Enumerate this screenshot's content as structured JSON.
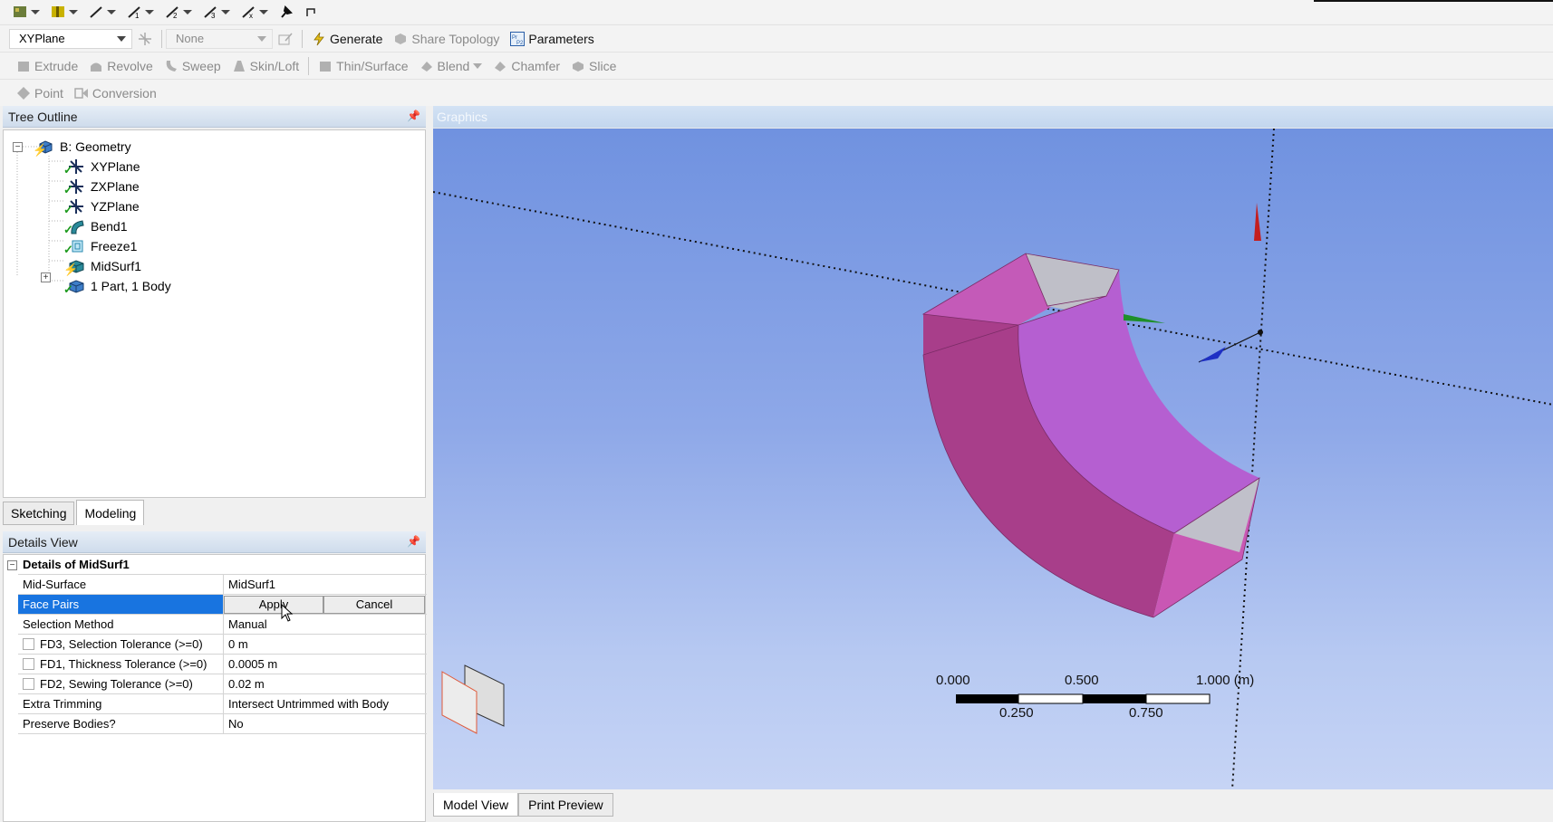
{
  "toolbar1": {
    "icons": [
      "new-sketch-icon",
      "layer-icon",
      "line-tool-1-icon",
      "line-tool-2-icon",
      "line-tool-3-icon",
      "line-tool-4-icon",
      "line-tool-x-icon",
      "pin-tool-icon",
      "select-box-icon"
    ]
  },
  "toolbar2": {
    "plane_select": "XYPlane",
    "sketch_select": "None",
    "generate": "Generate",
    "share_topology": "Share Topology",
    "parameters": "Parameters"
  },
  "toolbar3": {
    "extrude": "Extrude",
    "revolve": "Revolve",
    "sweep": "Sweep",
    "skin_loft": "Skin/Loft",
    "thin_surface": "Thin/Surface",
    "blend": "Blend",
    "chamfer": "Chamfer",
    "slice": "Slice"
  },
  "toolbar4": {
    "point": "Point",
    "conversion": "Conversion"
  },
  "tree": {
    "title": "Tree Outline",
    "root": "B: Geometry",
    "items": [
      "XYPlane",
      "ZXPlane",
      "YZPlane",
      "Bend1",
      "Freeze1",
      "MidSurf1",
      "1 Part, 1 Body"
    ]
  },
  "tabs": {
    "sketching": "Sketching",
    "modeling": "Modeling"
  },
  "details": {
    "title": "Details View",
    "section": "Details of MidSurf1",
    "rows": [
      {
        "key": "Mid-Surface",
        "value": "MidSurf1"
      },
      {
        "key": "Face Pairs",
        "value": ""
      },
      {
        "key": "Selection Method",
        "value": "Manual"
      },
      {
        "key": "FD3, Selection Tolerance (>=0)",
        "value": "0 m"
      },
      {
        "key": "FD1, Thickness Tolerance (>=0)",
        "value": "0.0005 m"
      },
      {
        "key": "FD2, Sewing Tolerance (>=0)",
        "value": "0.02 m"
      },
      {
        "key": "Extra Trimming",
        "value": "Intersect Untrimmed with Body"
      },
      {
        "key": "Preserve Bodies?",
        "value": "No"
      }
    ],
    "apply": "Apply",
    "cancel": "Cancel"
  },
  "graphics": {
    "title": "Graphics",
    "scale": {
      "top_labels": [
        "0.000",
        "0.500",
        "1.000 (m)"
      ],
      "bottom_labels": [
        "0.250",
        "0.750"
      ]
    },
    "tabs": {
      "model_view": "Model View",
      "print_preview": "Print Preview"
    }
  },
  "colors": {
    "selection_blue": "#1874e0",
    "body_pink": "#c45ab8",
    "background_top": "#7092e0",
    "background_bottom": "#c6d4f5"
  }
}
